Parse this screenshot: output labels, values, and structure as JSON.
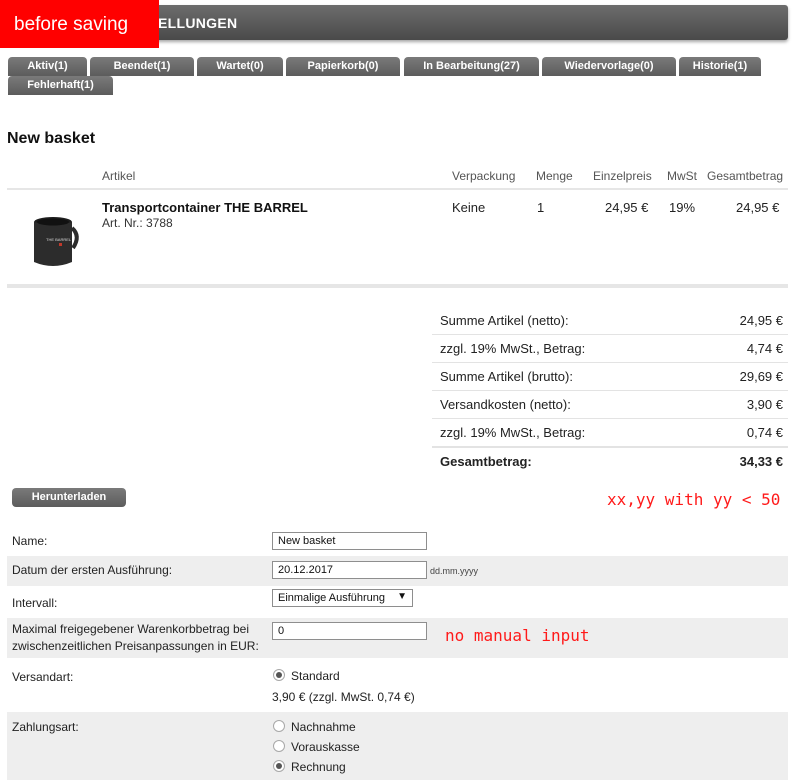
{
  "header": {
    "title": "ELLUNGEN"
  },
  "overlay": {
    "label": "before saving"
  },
  "tabs": [
    "Aktiv(1)",
    "Beendet(1)",
    "Wartet(0)",
    "Papierkorb(0)",
    "In Bearbeitung(27)",
    "Wiedervorlage(0)",
    "Historie(1)",
    "Fehlerhaft(1)"
  ],
  "page": {
    "title": "New basket"
  },
  "table": {
    "headers": {
      "artikel": "Artikel",
      "verpackung": "Verpackung",
      "menge": "Menge",
      "einzelpreis": "Einzelpreis",
      "mwst": "MwSt",
      "gesamtbetrag": "Gesamtbetrag"
    },
    "item": {
      "name": "Transportcontainer THE BARREL",
      "art_nr": "Art. Nr.: 3788",
      "verpackung": "Keine",
      "menge": "1",
      "einzelpreis": "24,95 €",
      "mwst": "19%",
      "gesamtbetrag": "24,95 €",
      "image_text": "THE BARREL"
    }
  },
  "summary": [
    {
      "label": "Summe Artikel (netto):",
      "value": "24,95 €"
    },
    {
      "label": "zzgl. 19% MwSt., Betrag:",
      "value": "4,74 €"
    },
    {
      "label": "Summe Artikel (brutto):",
      "value": "29,69 €"
    },
    {
      "label": "Versandkosten (netto):",
      "value": "3,90 €"
    },
    {
      "label": "zzgl. 19% MwSt., Betrag:",
      "value": "0,74 €"
    },
    {
      "label": "Gesamtbetrag:",
      "value": "34,33 €"
    }
  ],
  "download_button": "Herunterladen",
  "annotations": {
    "note1": "xx,yy with yy < 50",
    "note2": "no manual input"
  },
  "form": {
    "name_label": "Name:",
    "name_value": "New basket",
    "date_label": "Datum der ersten Ausführung:",
    "date_value": "20.12.2017",
    "date_hint": "dd.mm.yyyy",
    "interval_label": "Intervall:",
    "interval_value": "Einmalige Ausführung",
    "max_label_1": "Maximal freigegebener Warenkorbbetrag bei",
    "max_label_2": "zwischenzeitlichen Preisanpassungen in EUR:",
    "max_value": "0",
    "versand_label": "Versandart:",
    "versand_option": "Standard",
    "versand_price": "3,90 € (zzgl. MwSt. 0,74 €)",
    "zahlung_label": "Zahlungsart:",
    "zahlung_options": [
      "Nachnahme",
      "Vorauskasse",
      "Rechnung"
    ]
  },
  "colors": {
    "header_bg": "#5a5a5a",
    "tab_bg": "#6b6b6b",
    "overlay_red": "#ff0000",
    "annotation_red": "#ff1a1a"
  }
}
